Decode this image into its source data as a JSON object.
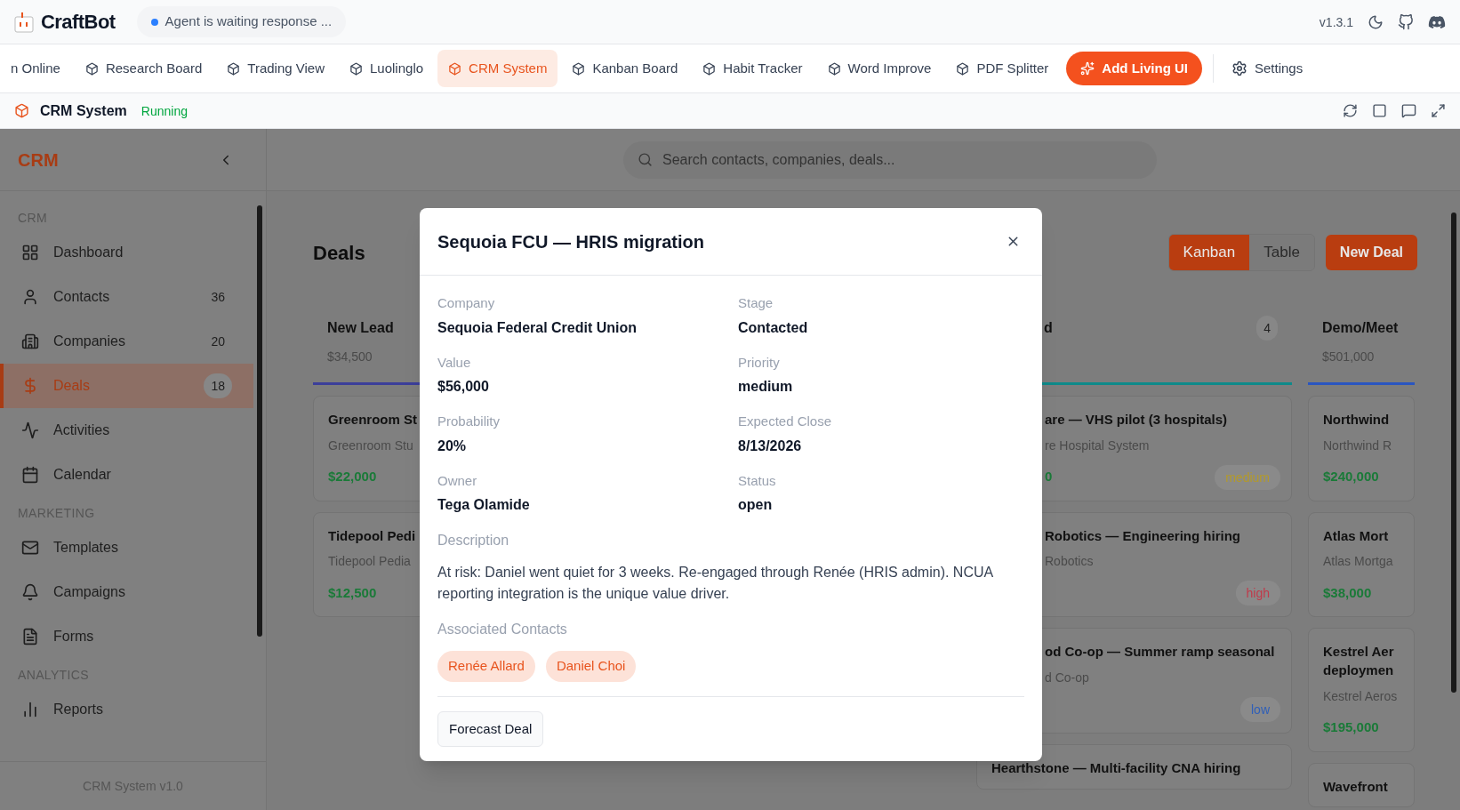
{
  "app": {
    "name": "CraftBot",
    "agent_status": "Agent is waiting response ...",
    "version": "v1.3.1"
  },
  "tabs": [
    {
      "label": "n Online",
      "selected": false
    },
    {
      "label": "Research Board",
      "selected": false
    },
    {
      "label": "Trading View",
      "selected": false
    },
    {
      "label": "Luolinglo",
      "selected": false
    },
    {
      "label": "CRM System",
      "selected": true
    },
    {
      "label": "Kanban Board",
      "selected": false
    },
    {
      "label": "Habit Tracker",
      "selected": false
    },
    {
      "label": "Word Improve",
      "selected": false
    },
    {
      "label": "PDF Splitter",
      "selected": false
    }
  ],
  "add_button": "Add Living UI",
  "settings": "Settings",
  "app_bar": {
    "title": "CRM System",
    "status": "Running"
  },
  "sidebar": {
    "title": "CRM",
    "footer": "CRM System v1.0",
    "sections": [
      {
        "heading": "CRM",
        "items": [
          {
            "label": "Dashboard",
            "selected": false
          },
          {
            "label": "Contacts",
            "count": "36",
            "selected": false
          },
          {
            "label": "Companies",
            "count": "20",
            "selected": false
          },
          {
            "label": "Deals",
            "count": "18",
            "selected": true
          },
          {
            "label": "Activities",
            "selected": false
          },
          {
            "label": "Calendar",
            "selected": false
          }
        ]
      },
      {
        "heading": "MARKETING",
        "items": [
          {
            "label": "Templates",
            "selected": false
          },
          {
            "label": "Campaigns",
            "selected": false
          },
          {
            "label": "Forms",
            "selected": false
          }
        ]
      },
      {
        "heading": "ANALYTICS",
        "items": [
          {
            "label": "Reports",
            "selected": false
          }
        ]
      }
    ]
  },
  "search": {
    "placeholder": "Search contacts, companies, deals..."
  },
  "page": {
    "title": "Deals",
    "views": [
      {
        "label": "Kanban",
        "selected": true
      },
      {
        "label": "Table",
        "selected": false
      }
    ],
    "new_button": "New Deal"
  },
  "columns": [
    {
      "name": "New Lead",
      "total": "$34,500",
      "color": "#3c3f9a",
      "covered": false,
      "cards": [
        {
          "title": "Greenroom St",
          "company": "Greenroom Stu",
          "value": "$22,000",
          "covered": false
        },
        {
          "title": "Tidepool Pedi",
          "company": "Tidepool Pedia",
          "value": "$12,500",
          "covered": false
        }
      ]
    },
    {
      "name": "d",
      "count": "4",
      "color": "#0e8a8a",
      "covered": true,
      "cards": [
        {
          "title": "are — VHS pilot (3 hospitals)",
          "company": "re Hospital System",
          "value": "0",
          "badge": {
            "label": "medium",
            "color": "#b39a2a"
          },
          "covered": true
        },
        {
          "title": "Robotics — Engineering hiring",
          "company": "Robotics",
          "badge": {
            "label": "high",
            "color": "#c03a4a"
          },
          "covered": true
        },
        {
          "title": "od Co-op — Summer ramp seasonal",
          "company": "d Co-op",
          "badge": {
            "label": "low",
            "color": "#2f5fb8"
          },
          "covered": true
        },
        {
          "title": "Hearthstone — Multi-facility CNA hiring",
          "covered": false
        }
      ]
    },
    {
      "name": "Demo/Meet",
      "total": "$501,000",
      "color": "#2a56c0",
      "covered": false,
      "cards": [
        {
          "title": "Northwind",
          "company": "Northwind R",
          "value": "$240,000",
          "covered": false
        },
        {
          "title": "Atlas Mort",
          "company": "Atlas Mortga",
          "value": "$38,000",
          "covered": false
        },
        {
          "title": "Kestrel Aer deploymen",
          "company": "Kestrel Aeros",
          "value": "$195,000",
          "covered": false
        },
        {
          "title": "Wavefront",
          "covered": false
        }
      ]
    }
  ],
  "modal": {
    "title": "Sequoia FCU — HRIS migration",
    "fields": [
      {
        "label": "Company",
        "value": "Sequoia Federal Credit Union"
      },
      {
        "label": "Stage",
        "value": "Contacted"
      },
      {
        "label": "Value",
        "value": "$56,000"
      },
      {
        "label": "Priority",
        "value": "medium"
      },
      {
        "label": "Probability",
        "value": "20%"
      },
      {
        "label": "Expected Close",
        "value": "8/13/2026"
      },
      {
        "label": "Owner",
        "value": "Tega Olamide"
      },
      {
        "label": "Status",
        "value": "open"
      }
    ],
    "description_label": "Description",
    "description": "At risk: Daniel went quiet for 3 weeks. Re-engaged through Renée (HRIS admin). NCUA reporting integration is the unique value driver.",
    "contacts_label": "Associated Contacts",
    "contacts": [
      "Renée Allard",
      "Daniel Choi"
    ],
    "action": "Forecast Deal"
  }
}
